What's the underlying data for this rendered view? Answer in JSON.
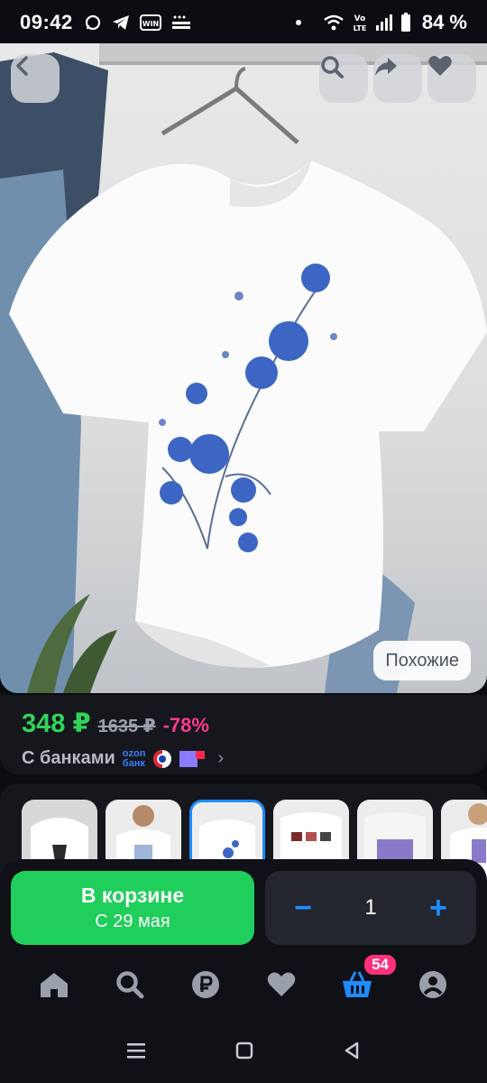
{
  "status_bar": {
    "time": "09:42",
    "battery": "84 %",
    "icons": [
      "whatsapp-icon",
      "telegram-icon",
      "win-icon",
      "detmir-icon",
      "dot-icon",
      "wifi-icon",
      "volte-icon",
      "signal-icon",
      "battery-icon"
    ]
  },
  "hero": {
    "back_icon": "chevron-left-icon",
    "search_icon": "search-icon",
    "share_icon": "share-icon",
    "favorite_icon": "heart-icon",
    "similar_label": "Похожие"
  },
  "price": {
    "current": "348 ₽",
    "old": "1635 ₽",
    "discount": "-78%",
    "bank_label": "С банками",
    "ozon_bank_line1": "ozon",
    "ozon_bank_line2": "банк"
  },
  "thumbnails": [
    {
      "name": "thumb-1"
    },
    {
      "name": "thumb-2"
    },
    {
      "name": "thumb-3",
      "active": true
    },
    {
      "name": "thumb-4"
    },
    {
      "name": "thumb-5"
    },
    {
      "name": "thumb-6"
    }
  ],
  "cart": {
    "title": "В корзине",
    "subtitle": "С 29 мая",
    "quantity": "1",
    "minus": "−",
    "plus": "+"
  },
  "bottom_nav": {
    "items": [
      "home-icon",
      "search-icon",
      "ruble-icon",
      "heart-icon",
      "basket-icon",
      "profile-icon"
    ],
    "cart_badge": "54"
  },
  "colors": {
    "accent_green": "#1fce5b",
    "price_green": "#33d35b",
    "discount_pink": "#ff3b8d",
    "accent_blue": "#1e8cff"
  }
}
